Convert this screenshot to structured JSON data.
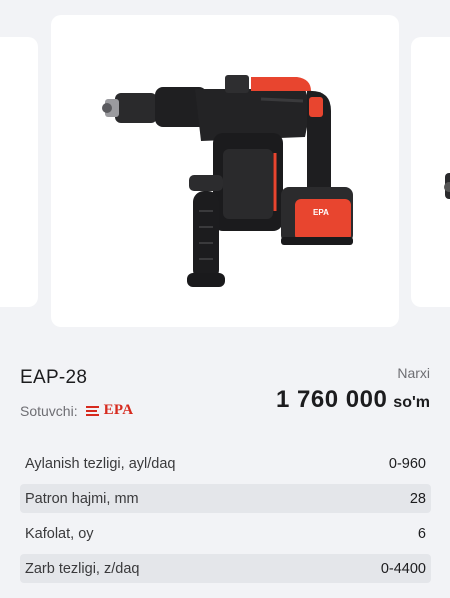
{
  "product": {
    "model": "EAP-28",
    "seller_label": "Sotuvchi:",
    "seller_logo_text": "EPA",
    "price_label": "Narxi",
    "price_value": "1 760 000",
    "price_currency": "so'm"
  },
  "gallery": {
    "main_image": "rotary-hammer-drill-image",
    "brand_accent": "#e8452f"
  },
  "specs": [
    {
      "label": "Aylanish tezligi, ayl/daq",
      "value": "0-960"
    },
    {
      "label": "Patron hajmi, mm",
      "value": "28"
    },
    {
      "label": "Kafolat, oy",
      "value": "6"
    },
    {
      "label": "Zarb tezligi, z/daq",
      "value": "0-4400"
    }
  ],
  "colors": {
    "page_bg": "#f2f3f6",
    "card_bg": "#ffffff",
    "row_shade": "#e4e6ea",
    "logo_red": "#d62a1e"
  }
}
